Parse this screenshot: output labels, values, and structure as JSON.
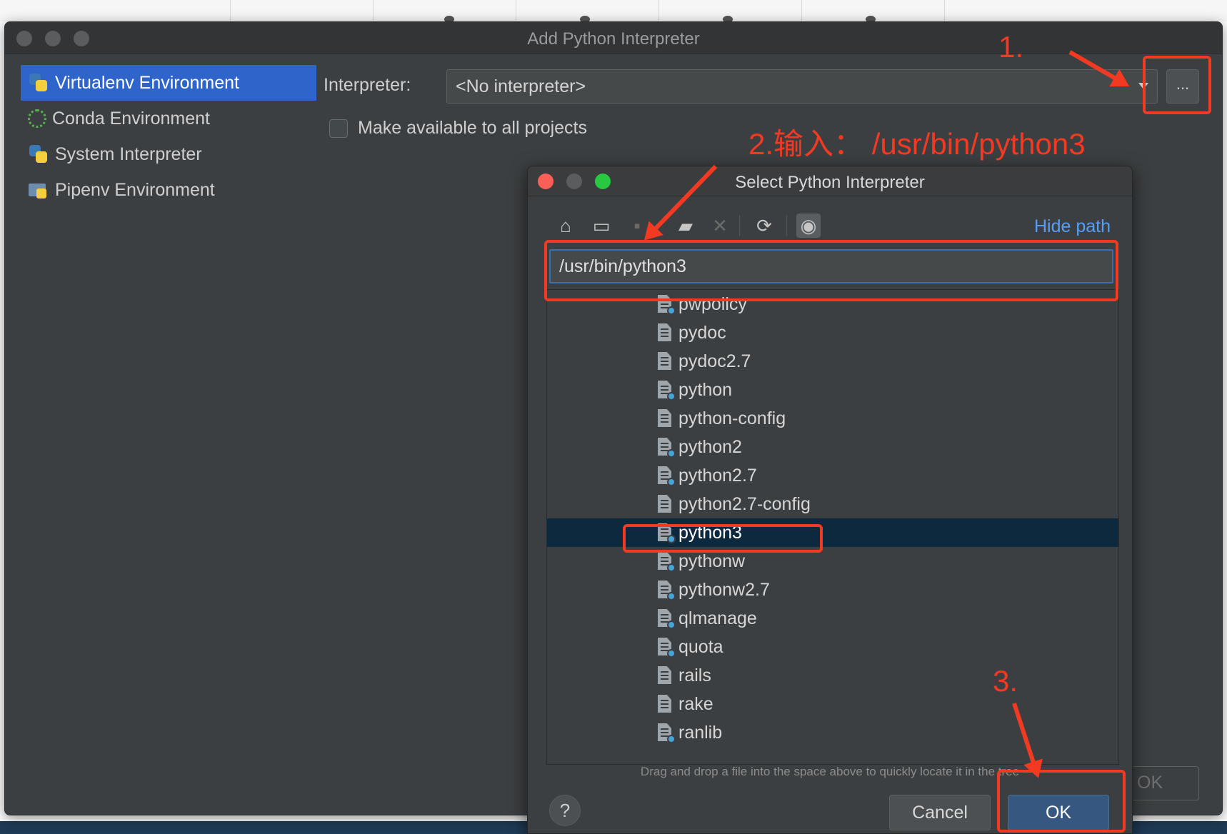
{
  "main_dialog": {
    "title": "Add Python Interpreter",
    "sidebar": [
      {
        "label": "Virtualenv Environment",
        "icon": "python-icon",
        "active": true
      },
      {
        "label": "Conda Environment",
        "icon": "conda-icon",
        "active": false
      },
      {
        "label": "System Interpreter",
        "icon": "python-icon",
        "active": false
      },
      {
        "label": "Pipenv Environment",
        "icon": "pipenv-icon",
        "active": false
      }
    ],
    "interpreter_label": "Interpreter:",
    "interpreter_value": "<No interpreter>",
    "browse_label": "...",
    "make_available_label": "Make available to all projects",
    "make_available_checked": false,
    "ok_label": "OK"
  },
  "select_dialog": {
    "title": "Select Python Interpreter",
    "hide_path_label": "Hide path",
    "path_value": "/usr/bin/python3",
    "files": [
      {
        "name": "pwpolicy",
        "python": true
      },
      {
        "name": "pydoc",
        "python": false
      },
      {
        "name": "pydoc2.7",
        "python": false
      },
      {
        "name": "python",
        "python": true
      },
      {
        "name": "python-config",
        "python": false
      },
      {
        "name": "python2",
        "python": true
      },
      {
        "name": "python2.7",
        "python": true
      },
      {
        "name": "python2.7-config",
        "python": false
      },
      {
        "name": "python3",
        "python": true,
        "selected": true
      },
      {
        "name": "pythonw",
        "python": true
      },
      {
        "name": "pythonw2.7",
        "python": true
      },
      {
        "name": "qlmanage",
        "python": true
      },
      {
        "name": "quota",
        "python": true
      },
      {
        "name": "rails",
        "python": false
      },
      {
        "name": "rake",
        "python": false
      },
      {
        "name": "ranlib",
        "python": true
      }
    ],
    "hint": "Drag and drop a file into the space above to quickly locate it in the tree",
    "help_label": "?",
    "cancel_label": "Cancel",
    "ok_label": "OK"
  },
  "annotations": {
    "step1": "1.",
    "step2": "2.输入： /usr/bin/python3",
    "step3": "3.",
    "color": "#f23a23"
  },
  "colors": {
    "accent": "#2f65ca",
    "ok_button": "#365880",
    "link": "#589df6",
    "selection": "#0d293e"
  }
}
